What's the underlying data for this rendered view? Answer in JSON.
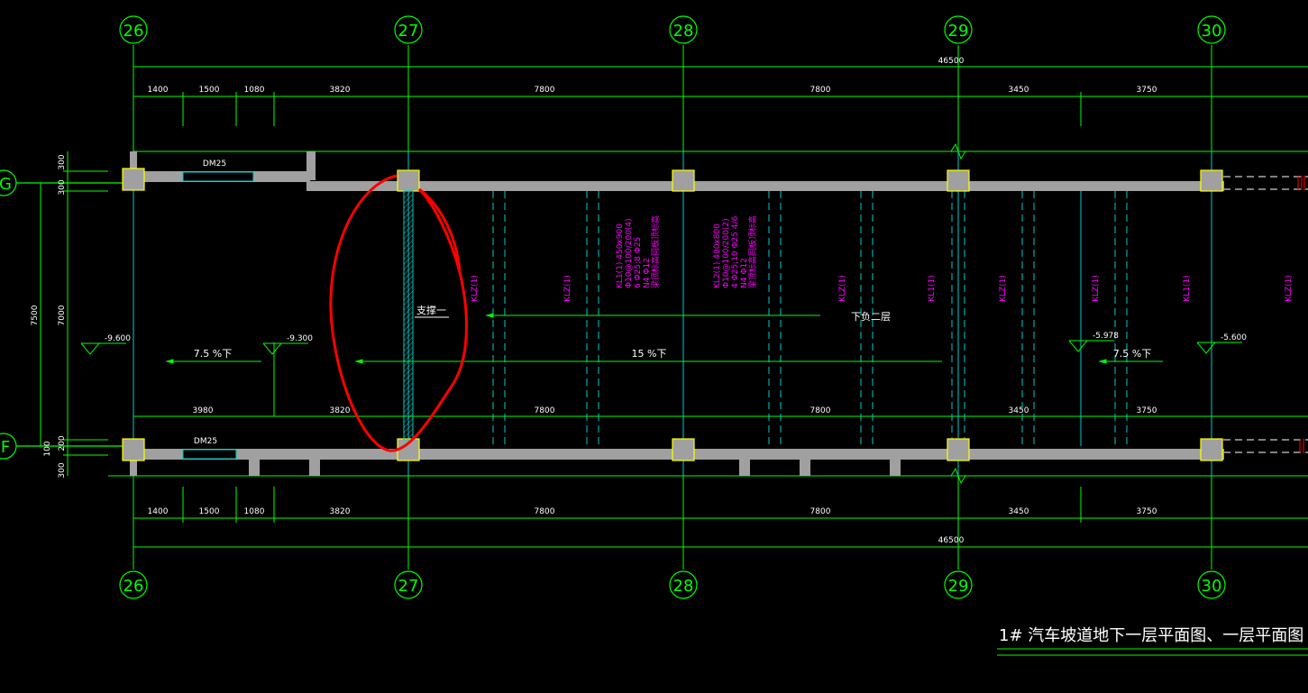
{
  "axes_bottom": [
    "26",
    "27",
    "28",
    "29",
    "30"
  ],
  "rows": [
    "G",
    "F"
  ],
  "overall_dim": "46500",
  "top_dims": [
    "1400",
    "1500",
    "1080",
    "3820",
    "7800",
    "7800",
    "3450",
    "3750"
  ],
  "mid_dims": [
    "3980",
    "3820",
    "7800",
    "7800",
    "3450",
    "3750"
  ],
  "bottom_dims": [
    "1400",
    "1500",
    "1080",
    "3820",
    "7800",
    "7800",
    "3450",
    "3750"
  ],
  "left_dims_outer": "7500",
  "left_dims_inner": [
    "300",
    "300",
    "7000",
    "200",
    "100",
    "300"
  ],
  "door_tags": [
    "DM25",
    "DM25"
  ],
  "levels": [
    "-9.600",
    "-9.300",
    "-5.978",
    "-5.600"
  ],
  "slopes": [
    "7.5 %下",
    "15 %下",
    "7.5 %下"
  ],
  "beam_labels": [
    "KLZ(1)",
    "KLZ(1)",
    "KLZ(1)",
    "KL1(1)",
    "KLZ(1)",
    "KLZ(1)",
    "KL1(1)",
    "KLZ(1)"
  ],
  "beam_detail_1": [
    "KL1(1) 450x900",
    "Φ10@100/200(4)",
    "6 Φ25;8 Φ25",
    "N4 Φ12",
    "梁顶标高同板顶标高"
  ],
  "beam_detail_2": [
    "KL2(1) 400x800",
    "Φ10@100/200(2)",
    "4 Φ25;10 Φ25 4/6",
    "N4 Φ12",
    "梁顶标高同板顶标高"
  ],
  "notes": {
    "support": "支撑一",
    "down": "下负二层"
  },
  "title": "1# 汽车坡道地下一层平面图、一层平面图",
  "colors": {
    "dim_green": "#00ff00",
    "axis_cyan": "#00cccc",
    "wall_gray": "#a0a0a0",
    "column_yellow": "#ffff00",
    "beam_magenta": "#ff00ff",
    "markup_red": "#ff0000"
  }
}
